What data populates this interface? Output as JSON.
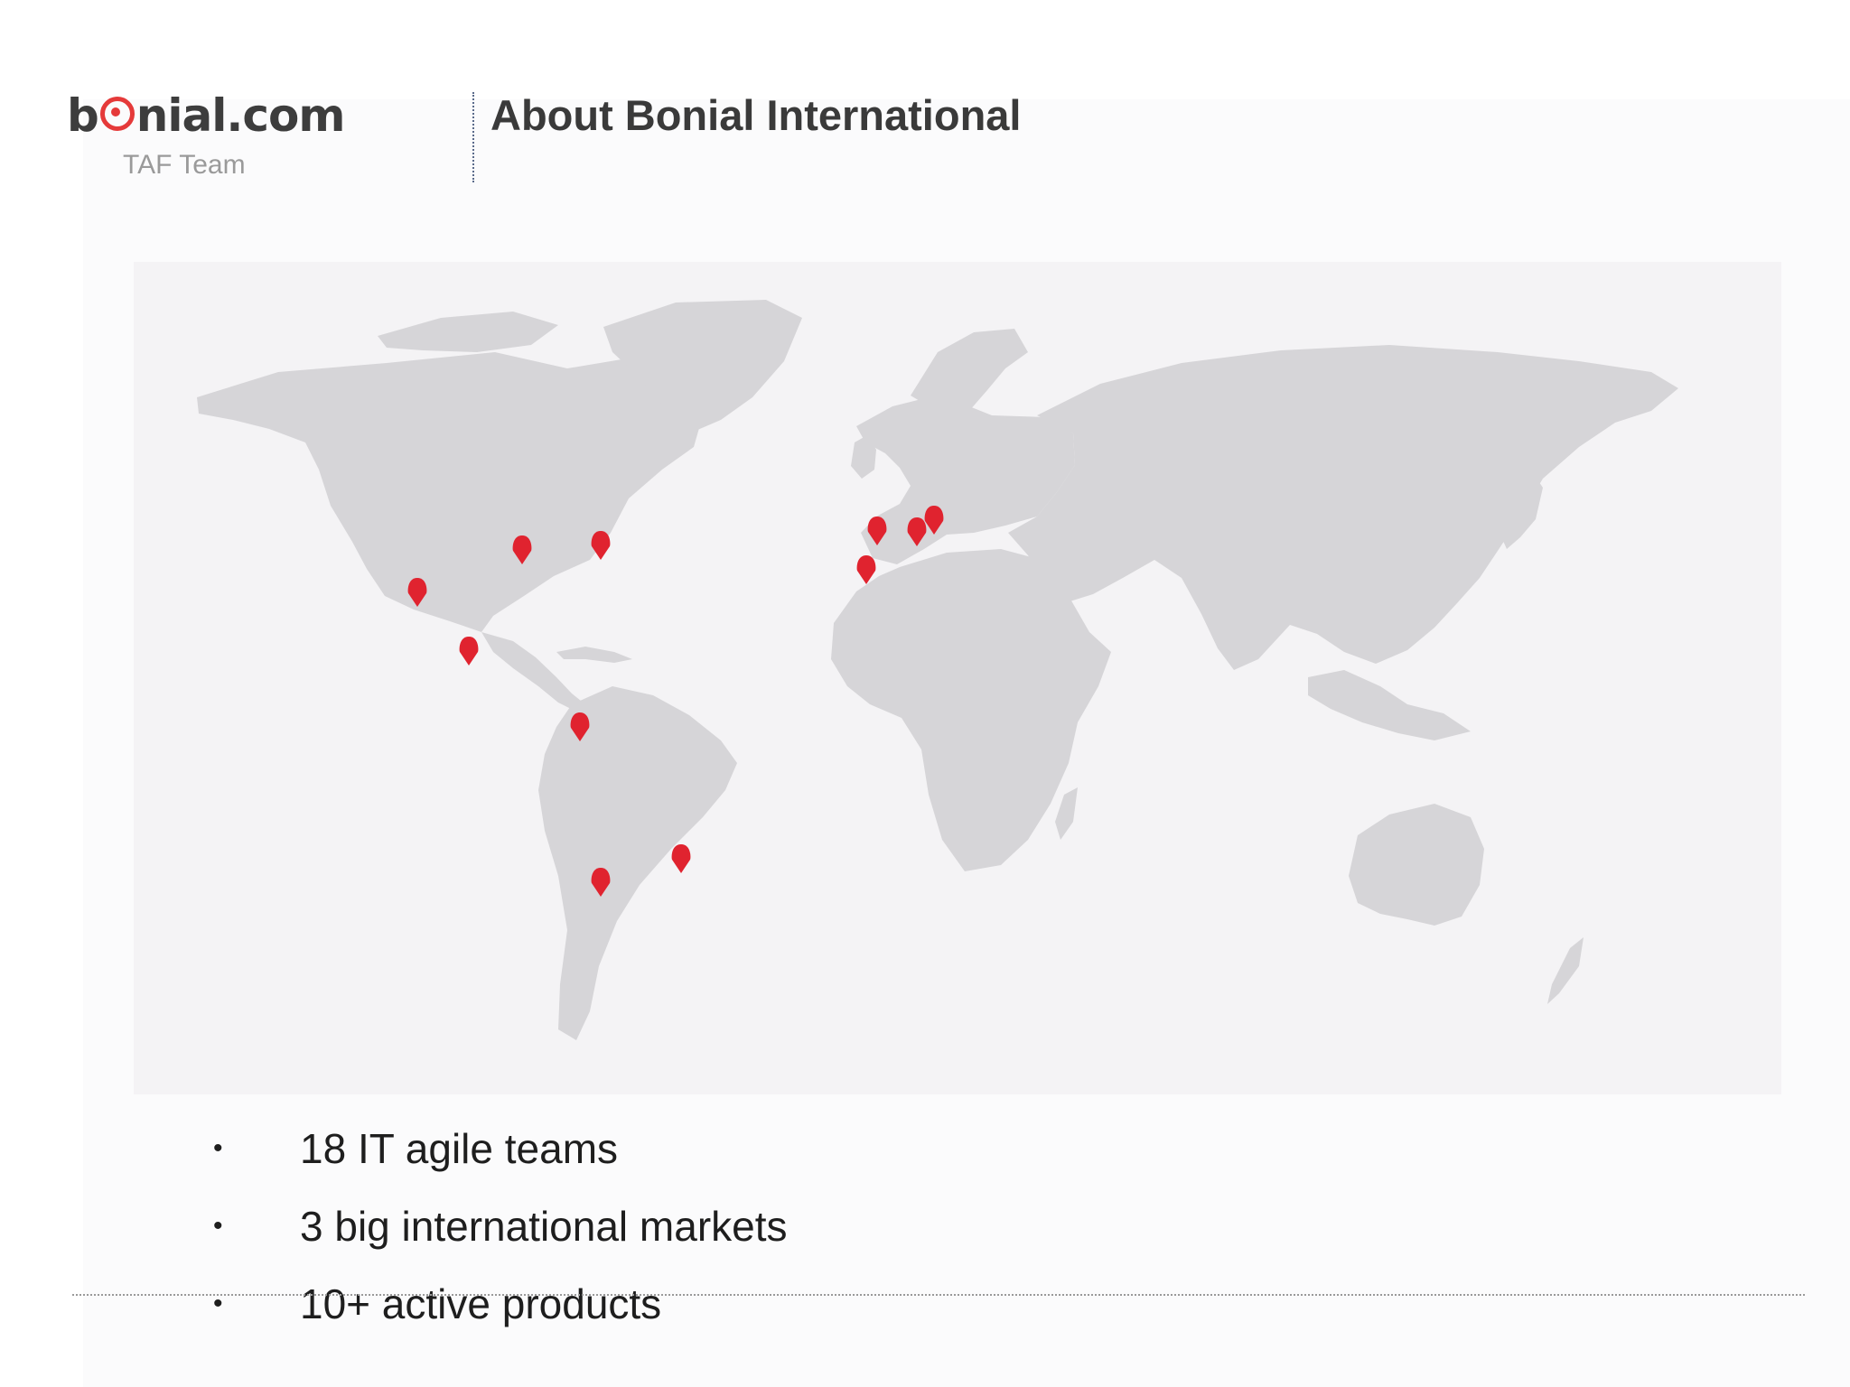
{
  "header": {
    "logo_prefix": "b",
    "logo_suffix": "nial.com",
    "subtitle": "TAF Team",
    "title": "About Bonial International"
  },
  "colors": {
    "accent": "#e53a3a",
    "land": "#d6d5d8",
    "map_background": "#f4f3f5",
    "pin": "#e0232f"
  },
  "map": {
    "marker_icon": "map-pin-icon",
    "markers": [
      "Vancouver",
      "Chicago",
      "Montreal",
      "Mexico",
      "Bogota",
      "Sao Paulo",
      "Santiago",
      "Paris",
      "Madrid",
      "Munich",
      "Berlin"
    ]
  },
  "bullets": [
    {
      "marker": "•",
      "text": "18 IT agile teams"
    },
    {
      "marker": "•",
      "text": "3 big international markets"
    },
    {
      "marker": "•",
      "text": "10+ active products"
    }
  ]
}
